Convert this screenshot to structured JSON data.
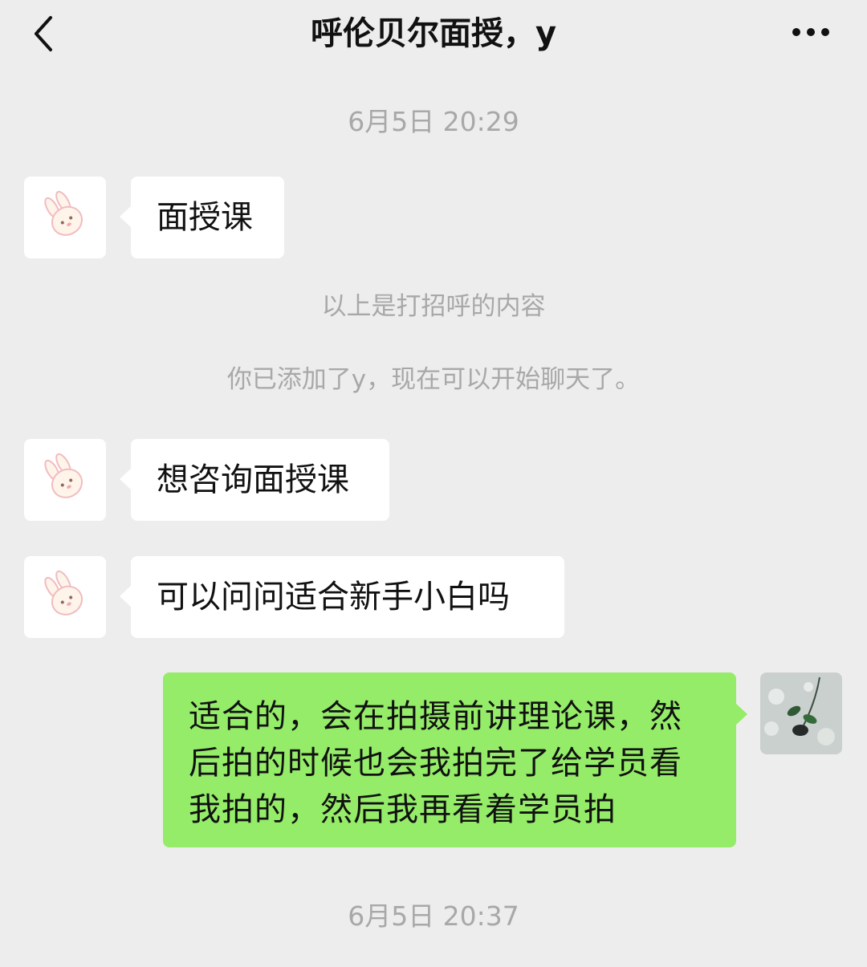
{
  "header": {
    "title": "呼伦贝尔面授，y",
    "back_icon": "chevron-left-icon",
    "more_icon": "more-icon"
  },
  "messages": [
    {
      "type": "timestamp",
      "text": "6月5日 20:29"
    },
    {
      "type": "incoming",
      "text": "面授课"
    },
    {
      "type": "system",
      "text": "以上是打招呼的内容"
    },
    {
      "type": "system",
      "text": "你已添加了y，现在可以开始聊天了。"
    },
    {
      "type": "incoming",
      "text": "想咨询面授课"
    },
    {
      "type": "incoming",
      "text": "可以问问适合新手小白吗"
    },
    {
      "type": "outgoing",
      "text": "适合的，会在拍摄前讲理论课，然后拍的时候也会我拍完了给学员看我拍的，然后我再看着学员拍"
    },
    {
      "type": "timestamp",
      "text": "6月5日 20:37"
    }
  ],
  "colors": {
    "background": "#ededed",
    "incoming_bubble": "#ffffff",
    "outgoing_bubble": "#95ec69",
    "meta_text": "#a8a8a8"
  },
  "icons": {
    "contact_avatar": "bunny-avatar-icon",
    "own_avatar": "flower-photo-avatar-icon"
  }
}
